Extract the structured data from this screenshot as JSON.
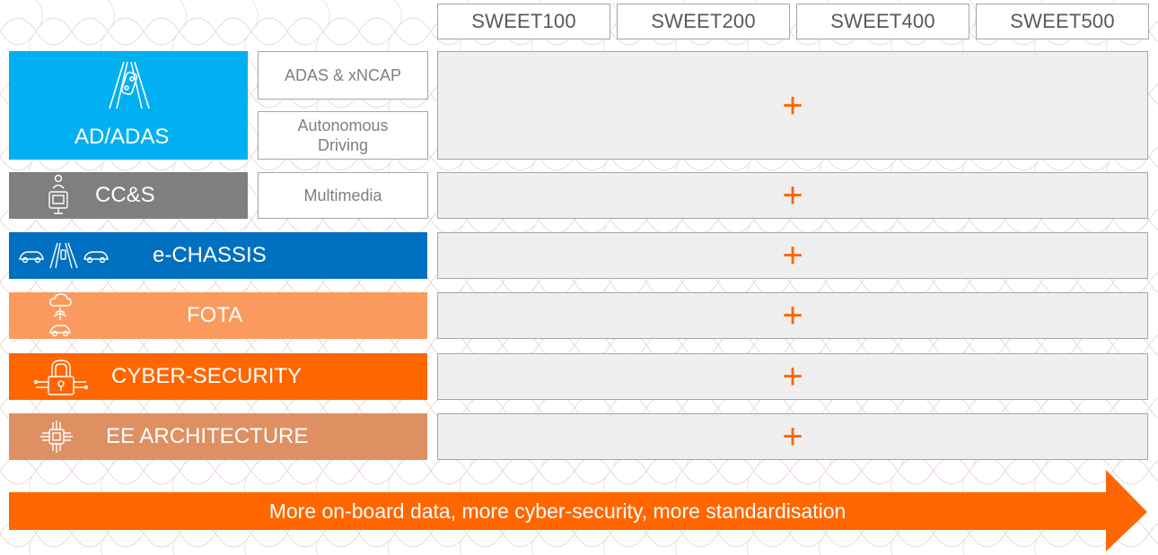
{
  "columns": [
    "SWEET100",
    "SWEET200",
    "SWEET400",
    "SWEET500"
  ],
  "rows": [
    {
      "label": "AD/ADAS",
      "color": "#00b0f0",
      "icon": "road-car-icon",
      "subs": [
        "ADAS & xNCAP",
        "Autonomous Driving"
      ],
      "cell": "+"
    },
    {
      "label": "CC&S",
      "color": "#7f7f7f",
      "icon": "connected-person-icon",
      "subs": [
        "Multimedia"
      ],
      "cell": "+"
    },
    {
      "label": "e-CHASSIS",
      "color": "#0070c0",
      "icon": "cars-road-icon",
      "subs": [],
      "cell": "+"
    },
    {
      "label": "FOTA",
      "color": "#fa9a5f",
      "icon": "cloud-car-icon",
      "subs": [],
      "cell": "+"
    },
    {
      "label": "CYBER-SECURITY",
      "color": "#ff6600",
      "icon": "padlock-circuit-icon",
      "subs": [],
      "cell": "+"
    },
    {
      "label": "EE ARCHITECTURE",
      "color": "#df9063",
      "icon": "chip-icon",
      "subs": [],
      "cell": "+"
    }
  ],
  "arrow": {
    "text": "More on-board data, more cyber-security, more standardisation",
    "color": "#ff6600"
  },
  "cell_color": "#efefef",
  "accent": "#ff6600"
}
